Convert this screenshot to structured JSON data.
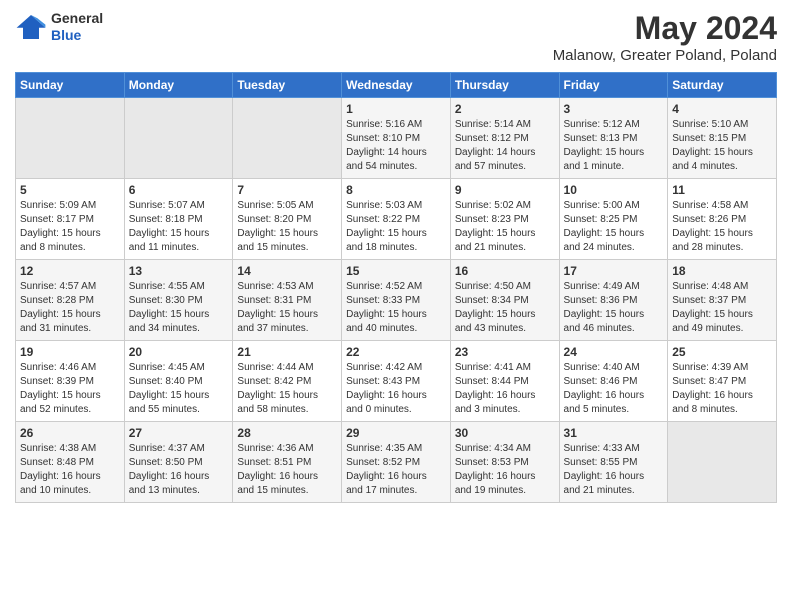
{
  "header": {
    "logo": {
      "general": "General",
      "blue": "Blue"
    },
    "title": "May 2024",
    "location": "Malanow, Greater Poland, Poland"
  },
  "weekdays": [
    "Sunday",
    "Monday",
    "Tuesday",
    "Wednesday",
    "Thursday",
    "Friday",
    "Saturday"
  ],
  "weeks": [
    [
      {
        "day": "",
        "info": ""
      },
      {
        "day": "",
        "info": ""
      },
      {
        "day": "",
        "info": ""
      },
      {
        "day": "1",
        "info": "Sunrise: 5:16 AM\nSunset: 8:10 PM\nDaylight: 14 hours\nand 54 minutes."
      },
      {
        "day": "2",
        "info": "Sunrise: 5:14 AM\nSunset: 8:12 PM\nDaylight: 14 hours\nand 57 minutes."
      },
      {
        "day": "3",
        "info": "Sunrise: 5:12 AM\nSunset: 8:13 PM\nDaylight: 15 hours\nand 1 minute."
      },
      {
        "day": "4",
        "info": "Sunrise: 5:10 AM\nSunset: 8:15 PM\nDaylight: 15 hours\nand 4 minutes."
      }
    ],
    [
      {
        "day": "5",
        "info": "Sunrise: 5:09 AM\nSunset: 8:17 PM\nDaylight: 15 hours\nand 8 minutes."
      },
      {
        "day": "6",
        "info": "Sunrise: 5:07 AM\nSunset: 8:18 PM\nDaylight: 15 hours\nand 11 minutes."
      },
      {
        "day": "7",
        "info": "Sunrise: 5:05 AM\nSunset: 8:20 PM\nDaylight: 15 hours\nand 15 minutes."
      },
      {
        "day": "8",
        "info": "Sunrise: 5:03 AM\nSunset: 8:22 PM\nDaylight: 15 hours\nand 18 minutes."
      },
      {
        "day": "9",
        "info": "Sunrise: 5:02 AM\nSunset: 8:23 PM\nDaylight: 15 hours\nand 21 minutes."
      },
      {
        "day": "10",
        "info": "Sunrise: 5:00 AM\nSunset: 8:25 PM\nDaylight: 15 hours\nand 24 minutes."
      },
      {
        "day": "11",
        "info": "Sunrise: 4:58 AM\nSunset: 8:26 PM\nDaylight: 15 hours\nand 28 minutes."
      }
    ],
    [
      {
        "day": "12",
        "info": "Sunrise: 4:57 AM\nSunset: 8:28 PM\nDaylight: 15 hours\nand 31 minutes."
      },
      {
        "day": "13",
        "info": "Sunrise: 4:55 AM\nSunset: 8:30 PM\nDaylight: 15 hours\nand 34 minutes."
      },
      {
        "day": "14",
        "info": "Sunrise: 4:53 AM\nSunset: 8:31 PM\nDaylight: 15 hours\nand 37 minutes."
      },
      {
        "day": "15",
        "info": "Sunrise: 4:52 AM\nSunset: 8:33 PM\nDaylight: 15 hours\nand 40 minutes."
      },
      {
        "day": "16",
        "info": "Sunrise: 4:50 AM\nSunset: 8:34 PM\nDaylight: 15 hours\nand 43 minutes."
      },
      {
        "day": "17",
        "info": "Sunrise: 4:49 AM\nSunset: 8:36 PM\nDaylight: 15 hours\nand 46 minutes."
      },
      {
        "day": "18",
        "info": "Sunrise: 4:48 AM\nSunset: 8:37 PM\nDaylight: 15 hours\nand 49 minutes."
      }
    ],
    [
      {
        "day": "19",
        "info": "Sunrise: 4:46 AM\nSunset: 8:39 PM\nDaylight: 15 hours\nand 52 minutes."
      },
      {
        "day": "20",
        "info": "Sunrise: 4:45 AM\nSunset: 8:40 PM\nDaylight: 15 hours\nand 55 minutes."
      },
      {
        "day": "21",
        "info": "Sunrise: 4:44 AM\nSunset: 8:42 PM\nDaylight: 15 hours\nand 58 minutes."
      },
      {
        "day": "22",
        "info": "Sunrise: 4:42 AM\nSunset: 8:43 PM\nDaylight: 16 hours\nand 0 minutes."
      },
      {
        "day": "23",
        "info": "Sunrise: 4:41 AM\nSunset: 8:44 PM\nDaylight: 16 hours\nand 3 minutes."
      },
      {
        "day": "24",
        "info": "Sunrise: 4:40 AM\nSunset: 8:46 PM\nDaylight: 16 hours\nand 5 minutes."
      },
      {
        "day": "25",
        "info": "Sunrise: 4:39 AM\nSunset: 8:47 PM\nDaylight: 16 hours\nand 8 minutes."
      }
    ],
    [
      {
        "day": "26",
        "info": "Sunrise: 4:38 AM\nSunset: 8:48 PM\nDaylight: 16 hours\nand 10 minutes."
      },
      {
        "day": "27",
        "info": "Sunrise: 4:37 AM\nSunset: 8:50 PM\nDaylight: 16 hours\nand 13 minutes."
      },
      {
        "day": "28",
        "info": "Sunrise: 4:36 AM\nSunset: 8:51 PM\nDaylight: 16 hours\nand 15 minutes."
      },
      {
        "day": "29",
        "info": "Sunrise: 4:35 AM\nSunset: 8:52 PM\nDaylight: 16 hours\nand 17 minutes."
      },
      {
        "day": "30",
        "info": "Sunrise: 4:34 AM\nSunset: 8:53 PM\nDaylight: 16 hours\nand 19 minutes."
      },
      {
        "day": "31",
        "info": "Sunrise: 4:33 AM\nSunset: 8:55 PM\nDaylight: 16 hours\nand 21 minutes."
      },
      {
        "day": "",
        "info": ""
      }
    ]
  ]
}
